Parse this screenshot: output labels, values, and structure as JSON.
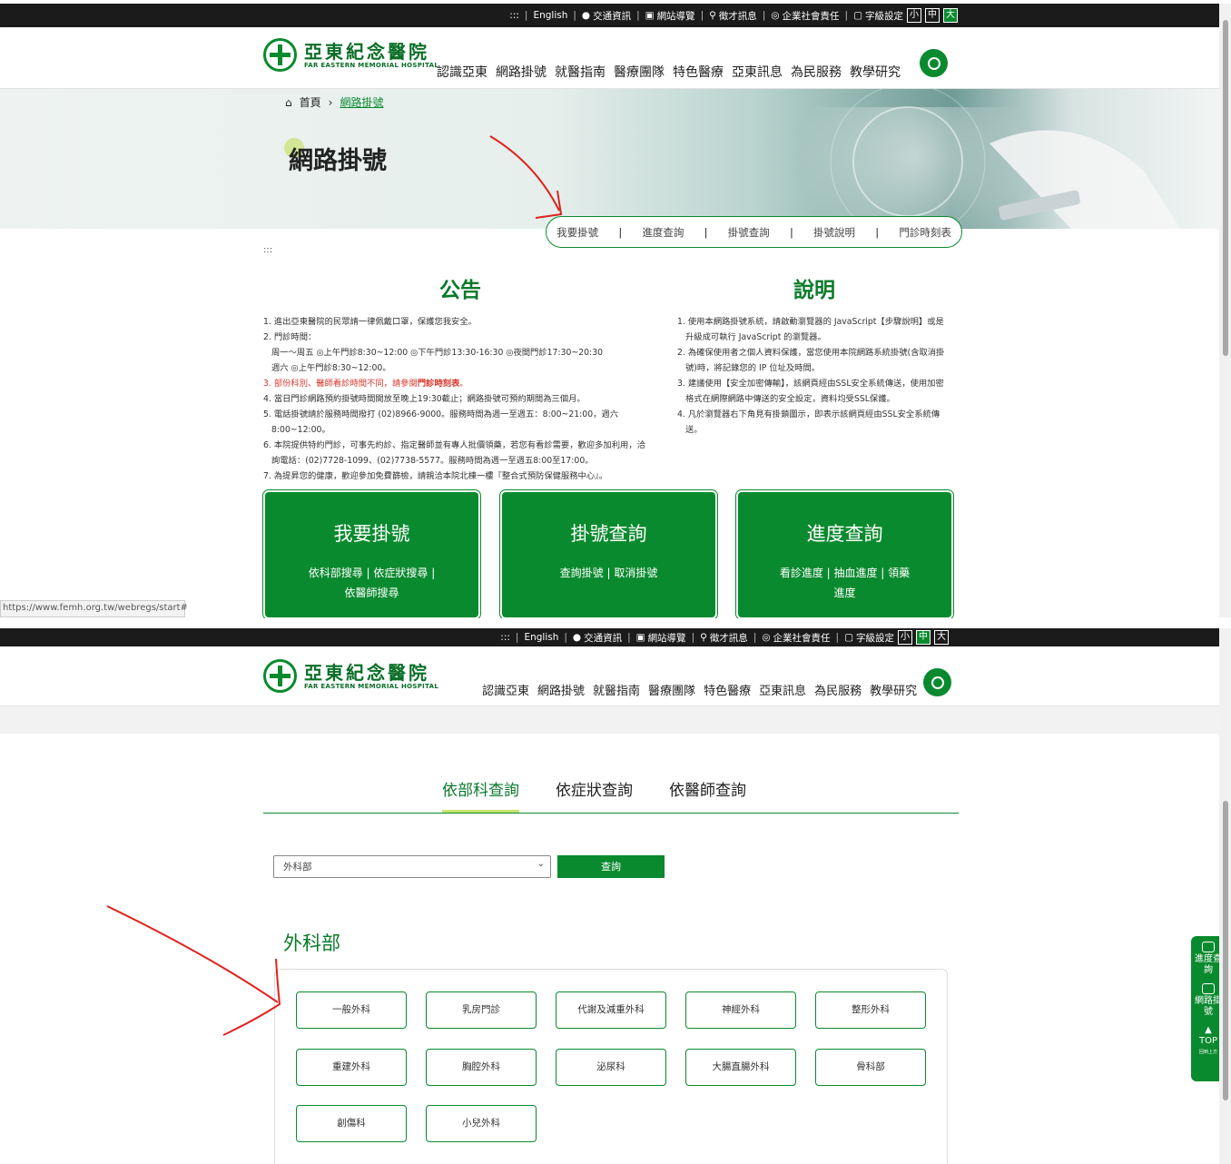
{
  "topbar": {
    "skip": ":::",
    "english": "English",
    "traffic": "交通資訊",
    "sitemap": "網站導覽",
    "jobs": "徵才訊息",
    "csr": "企業社會責任",
    "font_setting": "字級設定",
    "font_small": "小",
    "font_medium": "中",
    "font_large": "大"
  },
  "logo": {
    "cn": "亞東紀念醫院",
    "en": "FAR EASTERN MEMORIAL HOSPITAL"
  },
  "nav": [
    "認識亞東",
    "網路掛號",
    "就醫指南",
    "醫療團隊",
    "特色醫療",
    "亞東訊息",
    "為民服務",
    "教學研究"
  ],
  "breadcrumb": {
    "home": "首頁",
    "current": "網路掛號"
  },
  "page_title": "網路掛號",
  "subnav": [
    "我要掛號",
    "進度查詢",
    "掛號查詢",
    "掛號說明",
    "門診時刻表"
  ],
  "skip_marker": ":::",
  "announcement": {
    "title": "公告",
    "items": [
      "1. 進出亞東醫院的民眾請一律佩戴口罩，保護您我安全。",
      "2. 門診時間：",
      "周一～周五 ◎上午門診8:30~12:00 ◎下午門診13:30-16:30 ◎夜間門診17:30~20:30",
      "週六 ◎上午門診8:30~12:00。",
      "3. 部份科別、醫師看診時間不同，請參閱",
      "4. 當日門診網路預約掛號時間開放至晚上19:30截止；網路掛號可預約期間為三個月。",
      "5. 電話掛號請於服務時間撥打 (02)8966-9000。服務時間為週一至週五：8:00~21:00，週六",
      "8:00~12:00。",
      "6. 本院提供特約門診，可事先約診、指定醫師並有專人批價領藥，若您有看診需要，歡迎多加利用，洽",
      "詢電話：(02)7728-1099、(02)7738-5577。服務時間為週一至週五8:00至17:00。",
      "7. 為提昇您的健康，歡迎參加免費篩檢，請親洽本院北棟一樓『整合式預防保健服務中心』。"
    ],
    "schedule_link": "門診時刻表"
  },
  "explanation": {
    "title": "說明",
    "items": [
      "1. 使用本網路掛號系統，請啟動瀏覽器的 JavaScript【步驟說明】或是",
      "升級成可執行 JavaScript 的瀏覽器。",
      "2. 為確保使用者之個人資料保護，當您使用本院網路系統掛號(含取消掛",
      "號)時，將記錄您的 IP 位址及時間。",
      "3. 建議使用【安全加密傳輸】，該網頁經由SSL安全系統傳送，使用加密",
      "格式在網際網路中傳送的安全設定，資料均受SSL保護。",
      "4. 凡於瀏覽器右下角見有掛鎖圖示，即表示該網頁經由SSL安全系統傳",
      "送。"
    ]
  },
  "cards": [
    {
      "title": "我要掛號",
      "sub": "依科部搜尋 | 依症狀搜尋 | 依醫師搜尋"
    },
    {
      "title": "掛號查詢",
      "sub": "查詢掛號 | 取消掛號"
    },
    {
      "title": "進度查詢",
      "sub": "看診進度 | 抽血進度 | 領藥進度"
    }
  ],
  "status_url": "https://www.femh.org.tw/webregs/start#",
  "search_tabs": [
    "依部科查詢",
    "依症狀查詢",
    "依醫師查詢"
  ],
  "dept_select": {
    "value": "外科部",
    "button": "查詢"
  },
  "department": {
    "title": "外科部",
    "items": [
      "一般外科",
      "乳房門診",
      "代謝及減重外科",
      "神經外科",
      "整形外科",
      "重建外科",
      "胸腔外科",
      "泌尿科",
      "大腸直腸外科",
      "骨科部",
      "創傷科",
      "小兒外科"
    ]
  },
  "float_menu": {
    "progress": "進度查詢",
    "register": "網路掛號",
    "top": "TOP",
    "top_sub": "回到上方"
  },
  "colors": {
    "brand_green": "#0a8a2e",
    "accent_lime": "#c8e36c",
    "annotation_red": "#e0221d"
  }
}
